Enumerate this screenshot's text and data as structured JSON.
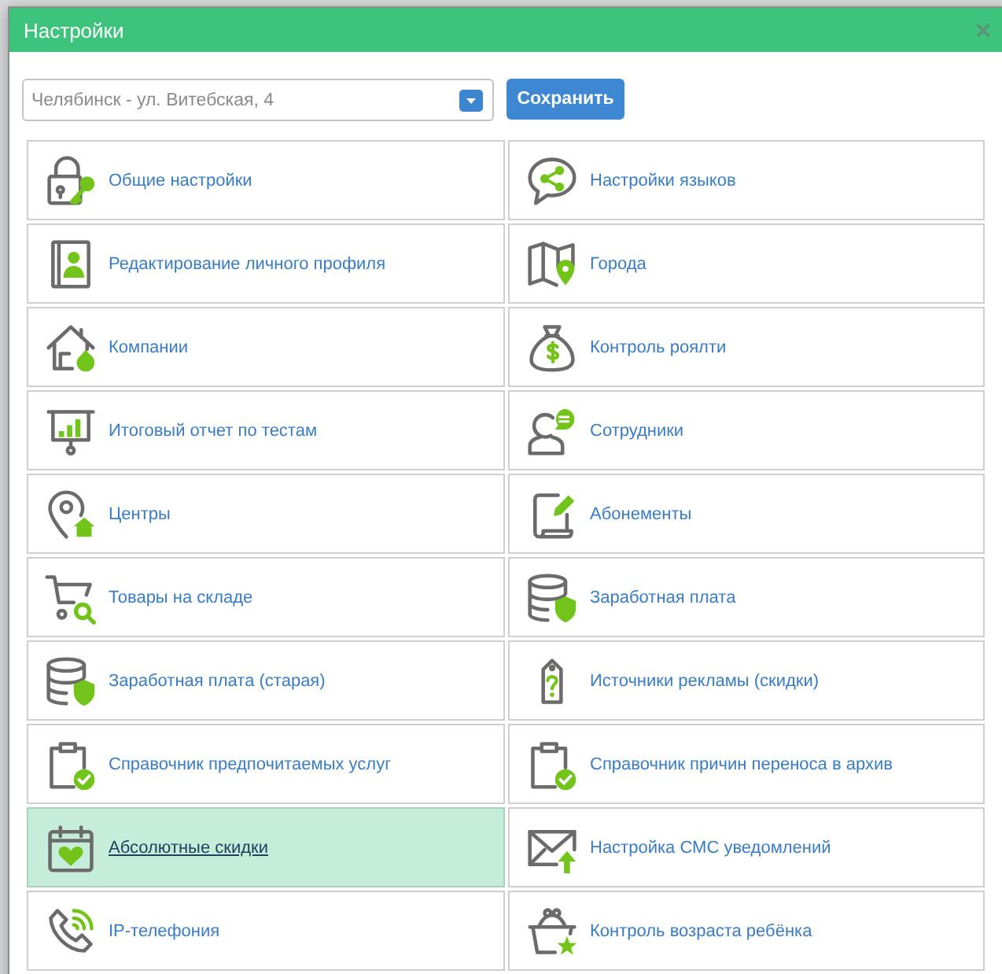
{
  "dialog": {
    "title": "Настройки",
    "close": "×"
  },
  "location_select": {
    "value": "Челябинск - ул. Витебская, 4"
  },
  "save_button": "Сохранить",
  "settings": [
    {
      "label": "Общие настройки",
      "selected": false
    },
    {
      "label": "Настройки языков",
      "selected": false
    },
    {
      "label": "Редактирование личного профиля",
      "selected": false
    },
    {
      "label": "Города",
      "selected": false
    },
    {
      "label": "Компании",
      "selected": false
    },
    {
      "label": "Контроль роялти",
      "selected": false
    },
    {
      "label": "Итоговый отчет по тестам",
      "selected": false
    },
    {
      "label": "Сотрудники",
      "selected": false
    },
    {
      "label": "Центры",
      "selected": false
    },
    {
      "label": "Абонементы",
      "selected": false
    },
    {
      "label": "Товары на складе",
      "selected": false
    },
    {
      "label": "Заработная плата",
      "selected": false
    },
    {
      "label": "Заработная плата (старая)",
      "selected": false
    },
    {
      "label": "Источники рекламы (скидки)",
      "selected": false
    },
    {
      "label": "Справочник предпочитаемых услуг",
      "selected": false
    },
    {
      "label": "Справочник причин переноса в архив",
      "selected": false
    },
    {
      "label": "Абсолютные скидки",
      "selected": true
    },
    {
      "label": "Настройка СМС уведомлений",
      "selected": false
    },
    {
      "label": "IP-телефония",
      "selected": false
    },
    {
      "label": "Контроль возраста ребёнка",
      "selected": false
    }
  ]
}
